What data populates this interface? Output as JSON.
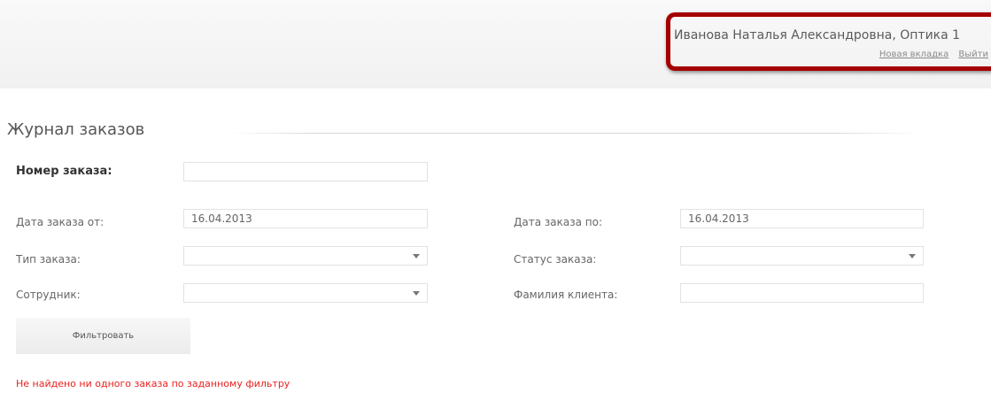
{
  "header": {
    "user_name": "Иванова Наталья Александровна, Оптика 1",
    "new_tab_link": "Новая вкладка",
    "logout_link": "Выйти"
  },
  "page": {
    "title": "Журнал заказов"
  },
  "filters": {
    "order_number_label": "Номер заказа:",
    "order_number_value": "",
    "date_from_label": "Дата заказа от:",
    "date_from_value": "16.04.2013",
    "date_to_label": "Дата заказа по:",
    "date_to_value": "16.04.2013",
    "order_type_label": "Тип заказа:",
    "order_type_value": "",
    "order_status_label": "Статус заказа:",
    "order_status_value": "",
    "employee_label": "Сотрудник:",
    "employee_value": "",
    "client_surname_label": "Фамилия клиента:",
    "client_surname_value": "",
    "filter_button": "Фильтровать"
  },
  "messages": {
    "no_results": "Не найдено ни одного заказа по заданному фильтру"
  },
  "colors": {
    "highlight_border": "#a50000",
    "error_text": "#e8221e"
  }
}
